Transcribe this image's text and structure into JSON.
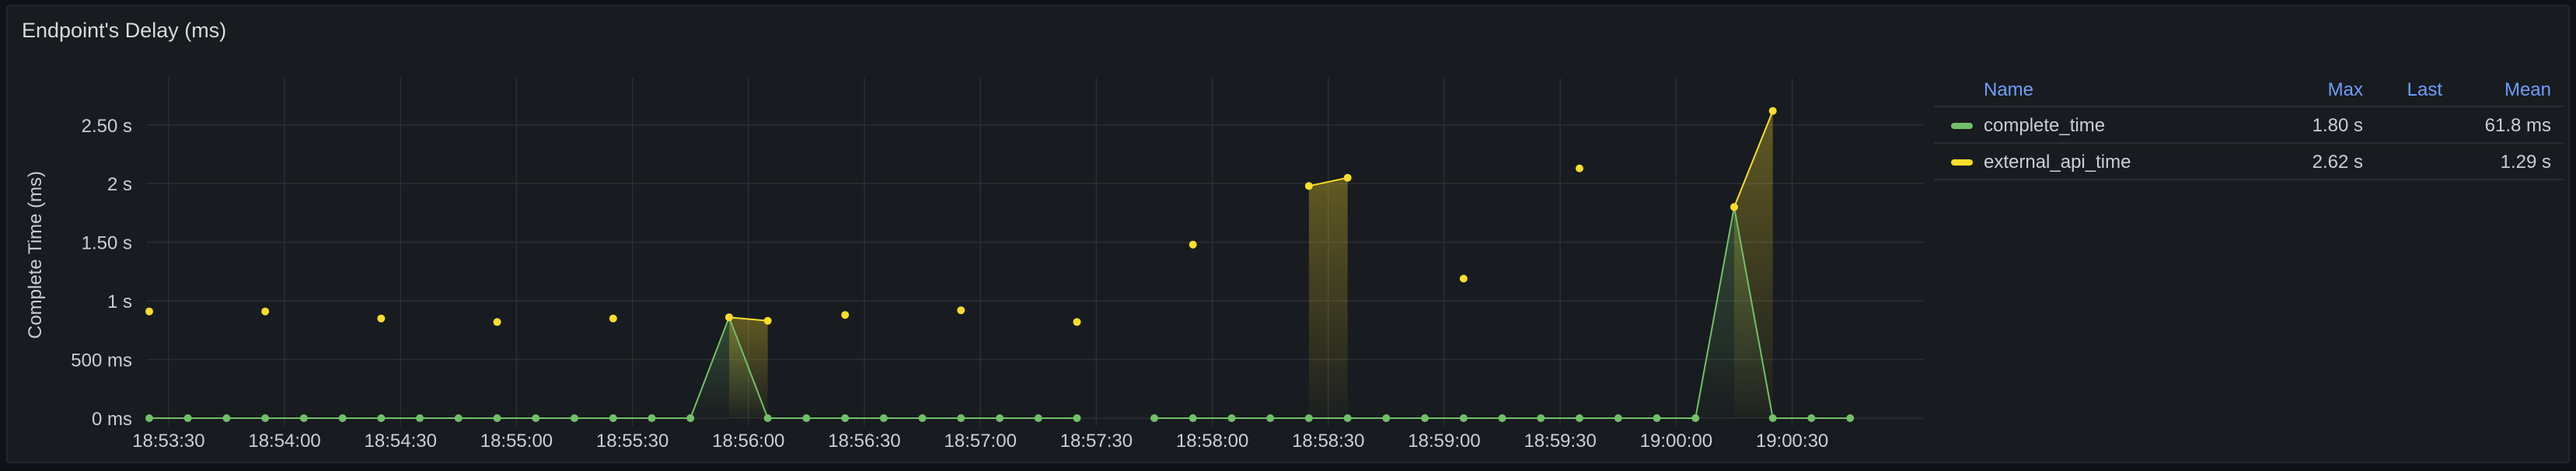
{
  "panel": {
    "title": "Endpoint's Delay (ms)"
  },
  "legend": {
    "headers": {
      "name": "Name",
      "max": "Max",
      "last": "Last",
      "mean": "Mean"
    },
    "rows": [
      {
        "name": "complete_time",
        "max": "1.80 s",
        "last": "",
        "mean": "61.8 ms",
        "color": "#73bf69"
      },
      {
        "name": "external_api_time",
        "max": "2.62 s",
        "last": "",
        "mean": "1.29 s",
        "color": "#fade2a"
      }
    ]
  },
  "chart_data": {
    "type": "line",
    "title": "",
    "xlabel": "",
    "ylabel": "Complete Time (ms)",
    "ylim": [
      0,
      2.85
    ],
    "xlim": [
      "18:53:25",
      "18:60:51"
    ],
    "y_ticks": [
      {
        "value": 0,
        "label": "0 ms"
      },
      {
        "value": 0.5,
        "label": "500 ms"
      },
      {
        "value": 1,
        "label": "1 s"
      },
      {
        "value": 1.5,
        "label": "1.50 s"
      },
      {
        "value": 2,
        "label": "2 s"
      },
      {
        "value": 2.5,
        "label": "2.50 s"
      }
    ],
    "x_ticks": [
      "18:53:30",
      "18:54:00",
      "18:54:30",
      "18:55:00",
      "18:55:30",
      "18:56:00",
      "18:56:30",
      "18:57:00",
      "18:57:30",
      "18:58:00",
      "18:58:30",
      "18:59:00",
      "18:59:30",
      "19:00:00",
      "19:00:30"
    ],
    "grid": true,
    "legend_position": "right",
    "series": [
      {
        "name": "complete_time",
        "color": "#73bf69",
        "points": [
          [
            "18:53:25",
            0
          ],
          [
            "18:53:35",
            0
          ],
          [
            "18:53:45",
            0
          ],
          [
            "18:53:55",
            0
          ],
          [
            "18:54:05",
            0
          ],
          [
            "18:54:15",
            0
          ],
          [
            "18:54:25",
            0
          ],
          [
            "18:54:35",
            0
          ],
          [
            "18:54:45",
            0
          ],
          [
            "18:54:55",
            0
          ],
          [
            "18:55:05",
            0
          ],
          [
            "18:55:15",
            0
          ],
          [
            "18:55:25",
            0
          ],
          [
            "18:55:35",
            0
          ],
          [
            "18:55:45",
            0
          ],
          [
            "18:55:55",
            0.86
          ],
          [
            "18:56:05",
            0
          ],
          [
            "18:56:15",
            0
          ],
          [
            "18:56:25",
            0
          ],
          [
            "18:56:35",
            0
          ],
          [
            "18:56:45",
            0
          ],
          [
            "18:56:55",
            0
          ],
          [
            "18:57:05",
            0
          ],
          [
            "18:57:15",
            0
          ],
          [
            "18:57:25",
            0
          ],
          null,
          [
            "18:57:45",
            0
          ],
          [
            "18:57:55",
            0
          ],
          [
            "18:58:05",
            0
          ],
          [
            "18:58:15",
            0
          ],
          [
            "18:58:25",
            0
          ],
          [
            "18:58:35",
            0
          ],
          [
            "18:58:45",
            0
          ],
          [
            "18:58:55",
            0
          ],
          [
            "18:59:05",
            0
          ],
          [
            "18:59:15",
            0
          ],
          [
            "18:59:25",
            0
          ],
          [
            "18:59:35",
            0
          ],
          [
            "18:59:45",
            0
          ],
          [
            "18:59:55",
            0
          ],
          [
            "19:00:05",
            0
          ],
          [
            "19:00:15",
            1.8
          ],
          [
            "19:00:25",
            0
          ],
          [
            "19:00:35",
            0
          ],
          [
            "19:00:45",
            0
          ]
        ]
      },
      {
        "name": "external_api_time",
        "color": "#fade2a",
        "points": [
          [
            "18:53:25",
            0.91
          ],
          null,
          [
            "18:53:55",
            0.91
          ],
          null,
          [
            "18:54:25",
            0.85
          ],
          null,
          [
            "18:54:55",
            0.82
          ],
          null,
          [
            "18:55:25",
            0.85
          ],
          null,
          [
            "18:55:55",
            0.86
          ],
          [
            "18:56:05",
            0.83
          ],
          null,
          [
            "18:56:25",
            0.88
          ],
          null,
          [
            "18:56:55",
            0.92
          ],
          null,
          [
            "18:57:25",
            0.82
          ],
          null,
          [
            "18:57:55",
            1.48
          ],
          null,
          [
            "18:58:25",
            1.98
          ],
          [
            "18:58:35",
            2.05
          ],
          null,
          [
            "18:59:05",
            1.19
          ],
          null,
          [
            "18:59:35",
            2.13
          ],
          null,
          [
            "19:00:15",
            1.8
          ],
          [
            "19:00:25",
            2.62
          ]
        ]
      }
    ]
  }
}
